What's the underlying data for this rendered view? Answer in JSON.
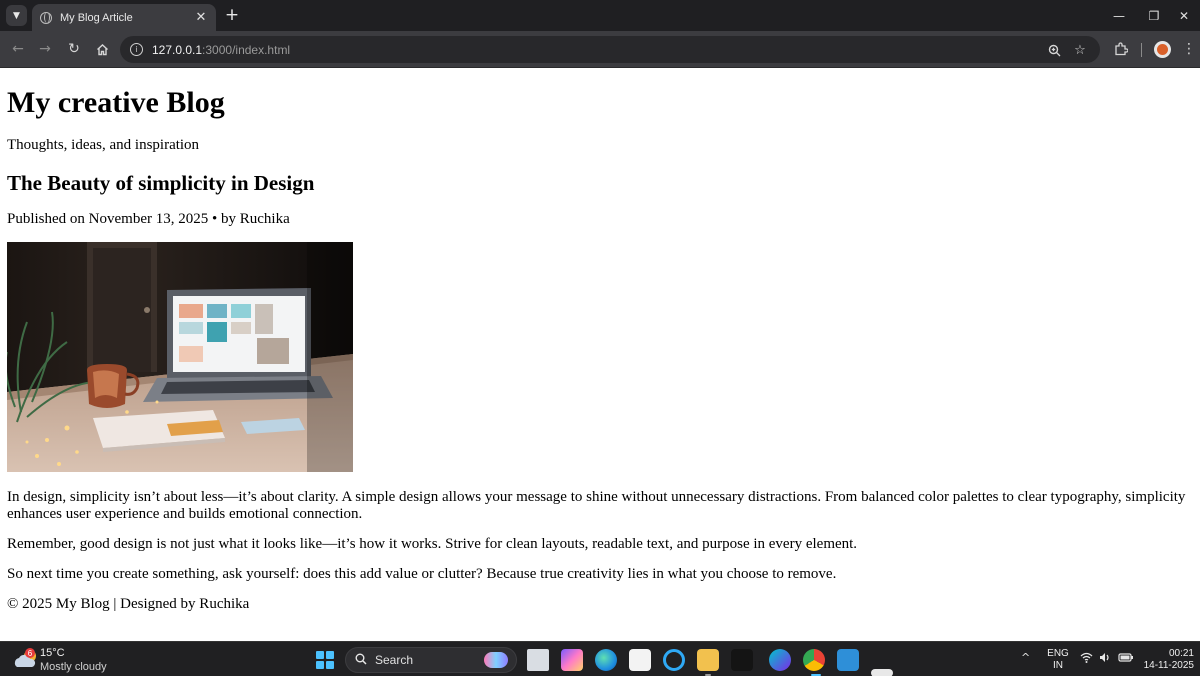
{
  "browser": {
    "tab_title": "My Blog Article",
    "url_host": "127.0.0.1",
    "url_path": ":3000/index.html",
    "icons": {
      "tab_search": "chevron-down-icon",
      "tab_close": "close-icon",
      "new_tab": "plus-icon",
      "back": "arrow-left-icon",
      "forward": "arrow-right-icon",
      "reload": "reload-icon",
      "home": "home-icon",
      "site_info": "info-icon",
      "zoom": "zoom-icon",
      "bookmark": "star-icon",
      "extensions": "puzzle-icon",
      "menu": "kebab-menu-icon"
    }
  },
  "blog": {
    "site_title": "My creative Blog",
    "tagline": "Thoughts, ideas, and inspiration",
    "article_title": "The Beauty of simplicity in Design",
    "meta": "Published on November 13, 2025 • by Ruchika",
    "paragraphs": [
      "In design, simplicity isn’t about less—it’s about clarity. A simple design allows your message to shine without unnecessary distractions. From balanced color palettes to clear typography, simplicity enhances user experience and builds emotional connection.",
      "Remember, good design is not just what it looks like—it’s how it works. Strive for clean layouts, readable text, and purpose in every element.",
      "So next time you create something, ask yourself: does this add value or clutter? Because true creativity lies in what you choose to remove."
    ],
    "footer": "© 2025 My Blog | Designed by Ruchika"
  },
  "taskbar": {
    "weather_badge": "6",
    "temperature": "15°C",
    "weather_desc": "Mostly cloudy",
    "search_label": "Search",
    "lang_line1": "ENG",
    "lang_line2": "IN",
    "time": "00:21",
    "date": "14-11-2025",
    "colors": {
      "accent": "#4cc2ff",
      "edge": "#1f8fe0",
      "vscode": "#2e8fd8"
    }
  }
}
